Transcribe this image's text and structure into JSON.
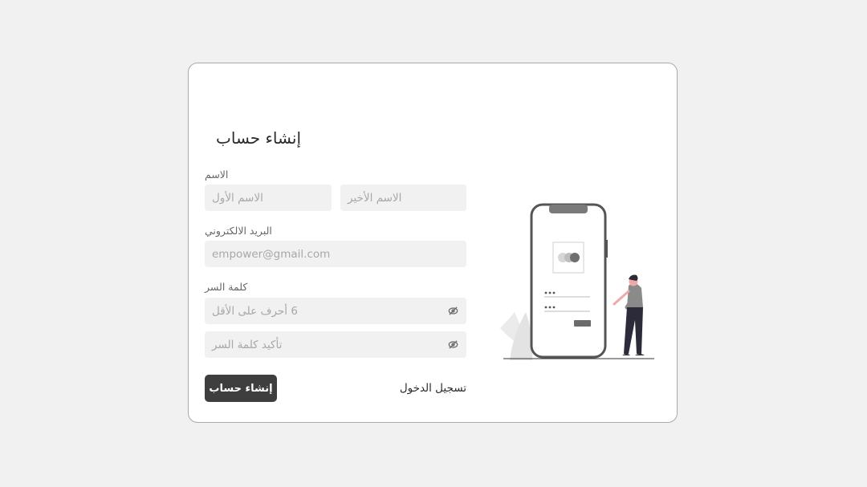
{
  "form": {
    "title": "إنشاء حساب",
    "name_label": "الاسم",
    "first_name_placeholder": "الاسم الأول",
    "last_name_placeholder": "الاسم الأخير",
    "email_label": "البريد الالكتروني",
    "email_placeholder": "empower@gmail.com",
    "password_label": "كلمة السر",
    "password_placeholder": "6 أحرف على الأقل",
    "confirm_password_placeholder": "تأكيد كلمة السر",
    "submit_label": "إنشاء حساب",
    "login_link": "تسجيل الدخول"
  },
  "icons": {
    "password_toggle": "eye-slash-icon",
    "illustration": "phone-signup-illustration"
  },
  "colors": {
    "page_background": "#f1f1f1",
    "card_background": "#ffffff",
    "field_background": "#f1f1f1",
    "button_background": "#3e3e3e",
    "accent_pink": "#f2a8a8"
  }
}
